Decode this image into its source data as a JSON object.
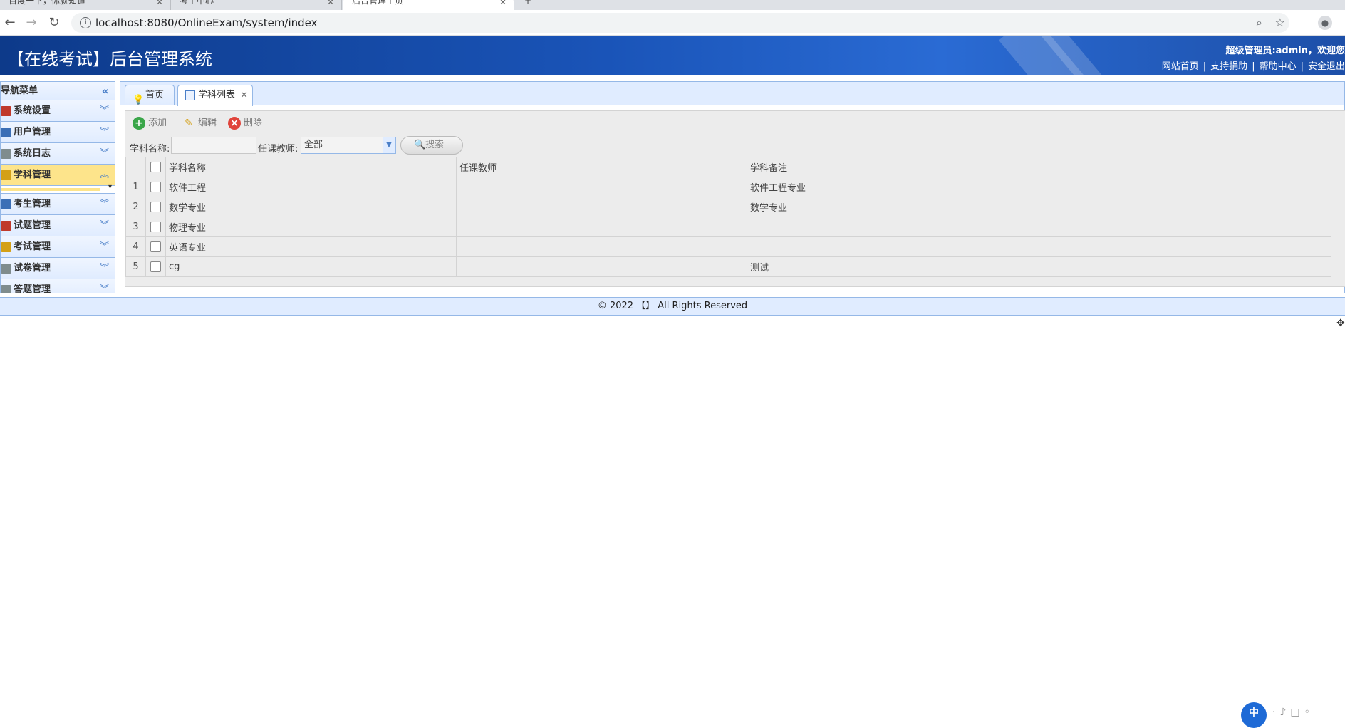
{
  "browser": {
    "tabs": [
      {
        "label": "百度一下，你就知道"
      },
      {
        "label": "考生中心"
      },
      {
        "label": "后台管理主页"
      }
    ],
    "url": "localhost:8080/OnlineExam/system/index"
  },
  "header": {
    "title": "【在线考试】后台管理系统",
    "user_info": "超级管理员:admin，欢迎您",
    "links": [
      "网站首页",
      "支持捐助",
      "帮助中心",
      "安全退出"
    ]
  },
  "nav": {
    "title": "导航菜单",
    "items": [
      {
        "label": "系统设置",
        "icon": "tools-icon",
        "color": "#c0392b"
      },
      {
        "label": "用户管理",
        "icon": "users-icon",
        "color": "#3b6fb6"
      },
      {
        "label": "系统日志",
        "icon": "log-icon",
        "color": "#7f8c8d"
      },
      {
        "label": "学科管理",
        "icon": "subject-icon",
        "color": "#d4a017",
        "active": true
      },
      {
        "label": "考生管理",
        "icon": "students-icon",
        "color": "#3b6fb6"
      },
      {
        "label": "试题管理",
        "icon": "calendar-icon",
        "color": "#c0392b"
      },
      {
        "label": "考试管理",
        "icon": "exam-icon",
        "color": "#d4a017"
      },
      {
        "label": "试卷管理",
        "icon": "paper-icon",
        "color": "#7f8c8d"
      },
      {
        "label": "答题管理",
        "icon": "answer-icon",
        "color": "#7f8c8d"
      }
    ]
  },
  "content": {
    "tabs": [
      {
        "label": "首页",
        "icon": "bulb-icon"
      },
      {
        "label": "学科列表",
        "icon": "table-icon",
        "closable": true
      }
    ],
    "toolbar": {
      "add": "添加",
      "edit": "编辑",
      "delete": "删除"
    },
    "search": {
      "name_label": "学科名称:",
      "name_value": "",
      "teacher_label": "任课教师:",
      "teacher_value": "全部",
      "button": "搜索"
    },
    "table": {
      "columns": [
        "学科名称",
        "任课教师",
        "学科备注"
      ],
      "rows": [
        {
          "num": "1",
          "name": "软件工程",
          "teacher": "",
          "remark": "软件工程专业"
        },
        {
          "num": "2",
          "name": "数学专业",
          "teacher": "",
          "remark": "数学专业"
        },
        {
          "num": "3",
          "name": "物理专业",
          "teacher": "",
          "remark": ""
        },
        {
          "num": "4",
          "name": "英语专业",
          "teacher": "",
          "remark": ""
        },
        {
          "num": "5",
          "name": "cg",
          "teacher": "",
          "remark": "测试"
        }
      ]
    }
  },
  "footer": {
    "text": "© 2022 【】 All Rights Reserved"
  },
  "colors": {
    "header_blue": "#1a54b8",
    "panel_border": "#95b8e7",
    "panel_bg": "#e0ecff",
    "active_nav": "#fde48b"
  }
}
